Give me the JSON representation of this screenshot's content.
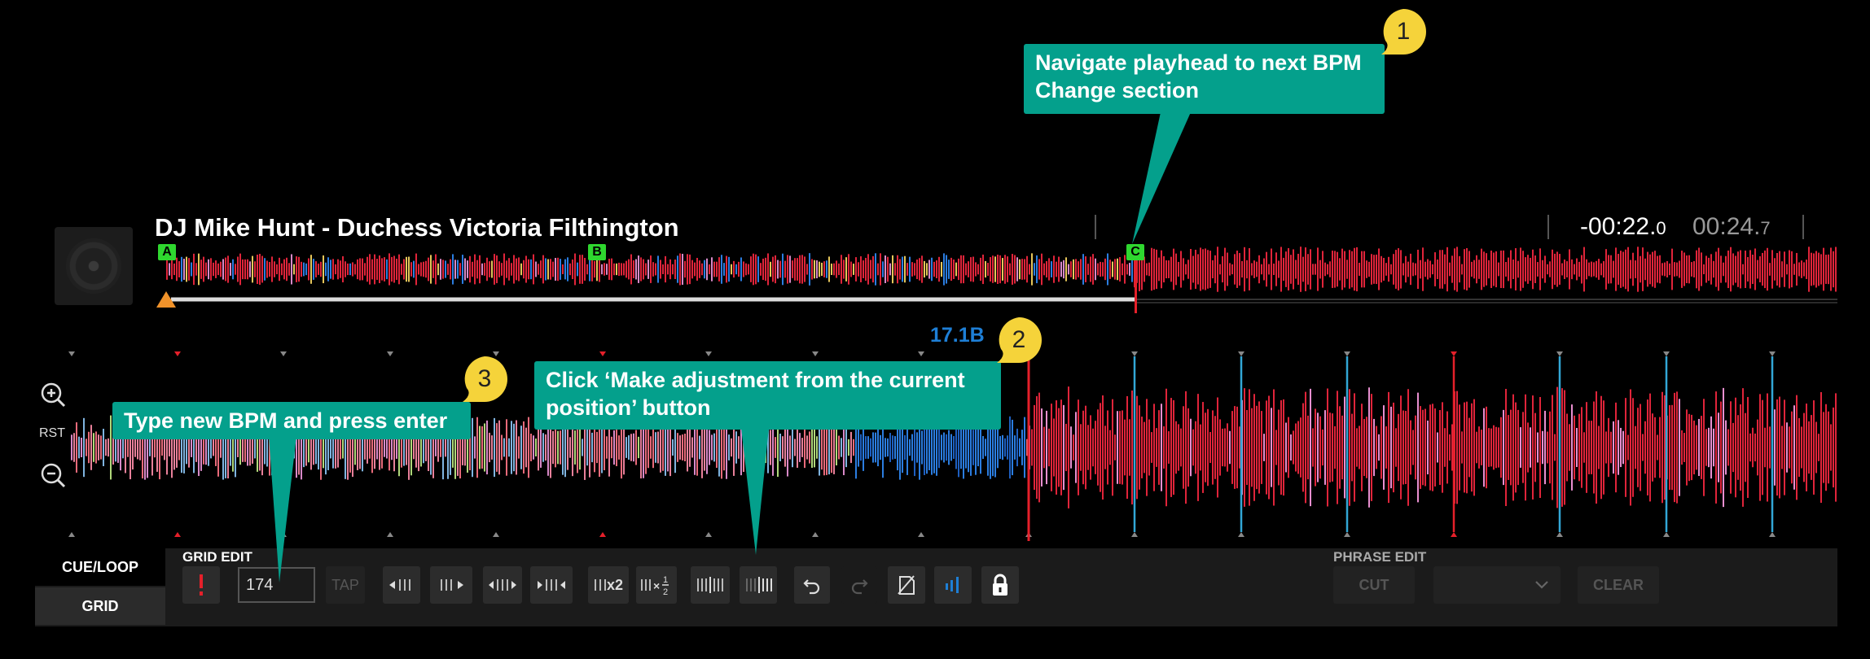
{
  "track": {
    "title": "DJ Mike Hunt - Duchess Victoria Filthington",
    "time_remaining": "-00:22.",
    "time_remaining_tenths": "0",
    "time_elapsed": "00:24.",
    "time_elapsed_tenths": "7"
  },
  "overview": {
    "cue_points": [
      {
        "label": "A"
      },
      {
        "label": "B"
      },
      {
        "label": "C"
      }
    ],
    "progress_fraction": 0.577
  },
  "detail": {
    "bpm_indicator": "17.1B",
    "reset_label": "RST"
  },
  "side_tabs": {
    "cue_loop": "CUE/LOOP",
    "grid": "GRID"
  },
  "grid_edit": {
    "title": "GRID EDIT",
    "bpm_value": "174",
    "tap_label": "TAP",
    "double_label": "x2"
  },
  "phrase_edit": {
    "title": "PHRASE EDIT",
    "cut_label": "CUT",
    "clear_label": "CLEAR"
  },
  "callouts": [
    {
      "number": "1",
      "text_line1": "Navigate playhead to next BPM",
      "text_line2": "Change section"
    },
    {
      "number": "2",
      "text_line1": "Click ‘Make adjustment from the current",
      "text_line2": "position’ button"
    },
    {
      "number": "3",
      "text_line1": "Type new BPM and press enter"
    }
  ],
  "colors": {
    "accent_blue": "#1e7fd6",
    "callout_bg": "#04a08c",
    "badge_yellow": "#f5d33a",
    "playhead_red": "#e5202a",
    "cue_green": "#2fd72f",
    "waveform_red": "#e0243a"
  }
}
